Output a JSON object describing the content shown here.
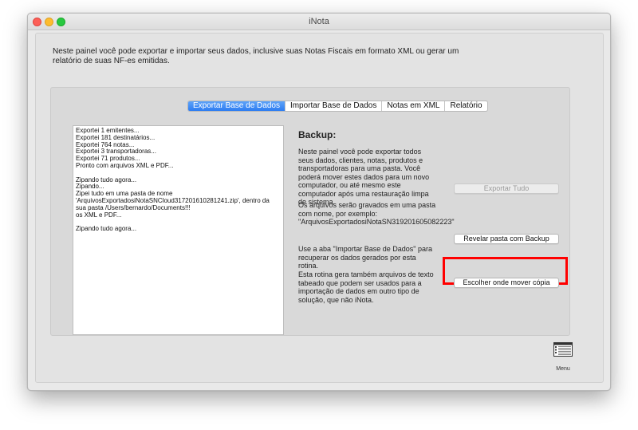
{
  "window": {
    "title": "iNota"
  },
  "intro": "Neste painel você pode exportar e importar seus dados, inclusive suas Notas Fiscais em formato XML ou gerar um relatório de suas NF-es emitidas.",
  "tabs": [
    {
      "label": "Exportar Base de Dados",
      "active": true
    },
    {
      "label": "Importar Base de Dados",
      "active": false
    },
    {
      "label": "Notas em XML",
      "active": false
    },
    {
      "label": "Relatório",
      "active": false
    }
  ],
  "log_lines": [
    "Exportei 1 emitentes...",
    "Exportei 181 destinatários...",
    "Exportei 764 notas...",
    "Exportei 3 transportadoras...",
    "Exportei 71 produtos...",
    "Pronto com arquivos XML e PDF...",
    "",
    "Zipando tudo agora...",
    "Zipando...",
    "Zipei tudo em uma pasta de nome 'ArquivosExportadosiNotaSNCloud317201610281241.zip', dentro da sua pasta /Users/bernardo/Documents!!!",
    "os XML e PDF...",
    "",
    "Zipando tudo agora..."
  ],
  "backup": {
    "title": "Backup:",
    "p1": "Neste painel você pode exportar todos seus dados, clientes, notas, produtos e transportadoras para uma pasta. Você poderá mover estes dados para um novo computador, ou até mesmo este computador após uma restauração limpa de sistema.",
    "p2": "Os arquivos serão gravados em uma pasta com nome, por exemplo: \"ArquivosExportadosiNotaSN319201605082223\"",
    "p3": "Use a aba \"Importar Base de Dados\" para recuperar os dados gerados por esta rotina.",
    "p4": "Esta rotina gera também arquivos de texto tabeado que podem ser usados para a importação de dados em outro tipo de solução, que não iNota."
  },
  "buttons": {
    "export_all": "Exportar Tudo",
    "reveal_folder": "Revelar pasta com Backup",
    "choose_copy": "Escolher onde mover cópia"
  },
  "menu": {
    "label": "Menu",
    "icon": "menu-calendar-icon"
  }
}
